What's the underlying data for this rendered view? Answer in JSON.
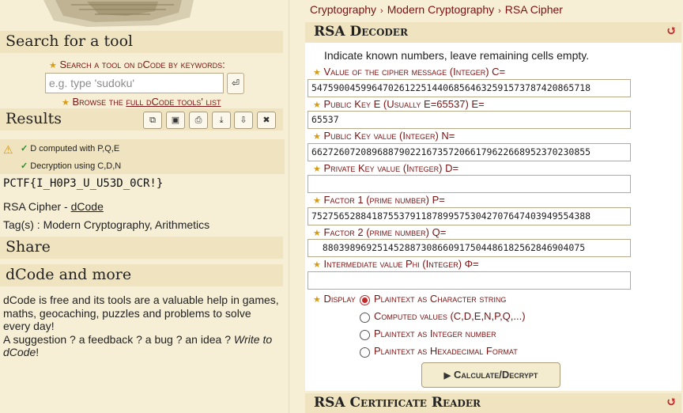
{
  "left": {
    "search_title": "Search for a tool",
    "search_label": "Search a tool on dCode by keywords:",
    "search_placeholder": "e.g. type 'sudoku'",
    "search_button": "⏎",
    "browse_prefix": "Browse the ",
    "browse_link": "full dCode tools' list",
    "results_title": "Results",
    "result_lines": [
      "D computed with P,Q,E",
      "Decryption using C,D,N"
    ],
    "flag": "PCTF{I_H0P3_U_U53D_0CR!}",
    "tool_prefix": "RSA Cipher - ",
    "tool_link": "dCode",
    "tags": "Tag(s) : Modern Cryptography, Arithmetics",
    "share_title": "Share",
    "more_title": "dCode and more",
    "more_text_1": "dCode is free and its tools are a valuable help in games, maths, geocaching, puzzles and problems to solve every day!",
    "more_text_2": "A suggestion ? a feedback ? a bug ? an idea ? ",
    "more_text_link": "Write to dCode",
    "more_text_end": "!"
  },
  "right": {
    "breadcrumb": [
      "Cryptography",
      "Modern Cryptography",
      "RSA Cipher"
    ],
    "decoder_title": "RSA Decoder",
    "indicate": "Indicate known numbers, leave remaining cells empty.",
    "fields": [
      {
        "label": "Value of the cipher message (Integer) C=",
        "value": "547590045996470261225144068564632591573787420865718"
      },
      {
        "label": "Public Key E (Usually E=65537) E=",
        "value": "65537"
      },
      {
        "label": "Public Key value (Integer) N=",
        "value": "662726072089688790221673572066179622668952370230855"
      },
      {
        "label": "Private Key value (Integer) D=",
        "value": ""
      },
      {
        "label": "Factor 1 (prime number) P=",
        "value": "752756528841875537911878995753042707647403949554388"
      },
      {
        "label": "Factor 2 (prime number) Q=",
        "value": "  880398969251452887308660917504486182562846904075"
      },
      {
        "label": "Intermediate value Phi (Integer) Φ=",
        "value": ""
      }
    ],
    "display_label": "Display",
    "display_options": [
      "Plaintext as Character string",
      "Computed values (C,D,E,N,P,Q,...)",
      "Plaintext as Integer number",
      "Plaintext as Hexadecimal Format"
    ],
    "selected_option": 0,
    "calc_button": "Calculate/Decrypt",
    "next_title": "RSA Certificate Reader"
  },
  "icons": {
    "reset": "reset-icon",
    "star": "star-icon",
    "warning": "warning-icon",
    "check": "check-icon"
  },
  "colors": {
    "accent": "#7a1212",
    "star": "#d89a12",
    "background": "#f6efd6",
    "section": "#efe3c0"
  }
}
